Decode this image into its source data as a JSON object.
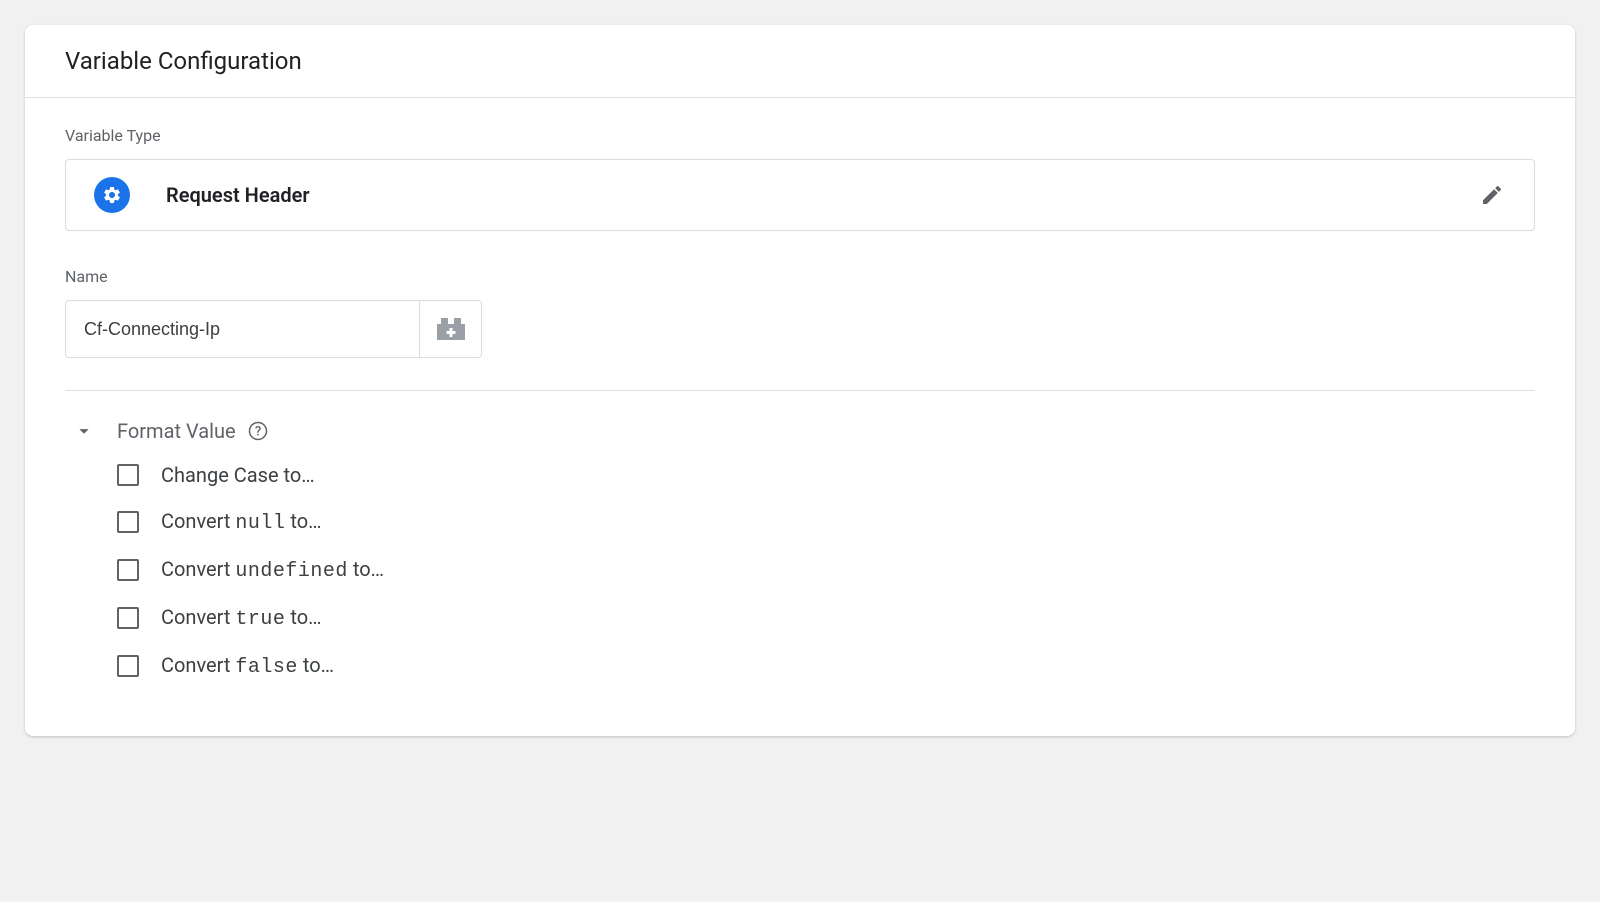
{
  "header": {
    "title": "Variable Configuration"
  },
  "variableType": {
    "label": "Variable Type",
    "name": "Request Header",
    "iconName": "gear-icon"
  },
  "nameField": {
    "label": "Name",
    "value": "Cf-Connecting-Ip"
  },
  "formatValue": {
    "title": "Format Value",
    "expanded": true,
    "options": [
      {
        "prefix": "Change Case to…",
        "code": ""
      },
      {
        "prefix": "Convert ",
        "code": "null",
        "suffix": " to…"
      },
      {
        "prefix": "Convert ",
        "code": "undefined",
        "suffix": " to…"
      },
      {
        "prefix": "Convert ",
        "code": "true",
        "suffix": " to…"
      },
      {
        "prefix": "Convert ",
        "code": "false",
        "suffix": " to…"
      }
    ]
  }
}
